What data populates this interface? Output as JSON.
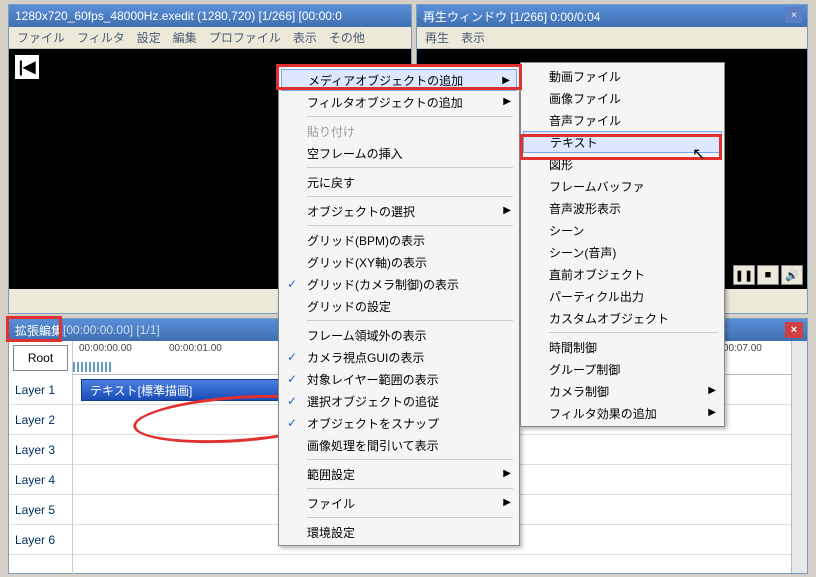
{
  "main_window": {
    "title": "1280x720_60fps_48000Hz.exedit (1280,720)  [1/266]  [00:00:0",
    "menubar": [
      "ファイル",
      "フィルタ",
      "設定",
      "編集",
      "プロファイル",
      "表示",
      "その他"
    ],
    "home_glyph": "|◀"
  },
  "playback_window": {
    "title": "再生ウィンドウ  [1/266]  0:00/0:04",
    "menubar": [
      "再生",
      "表示"
    ],
    "controls": {
      "pause": "❚❚",
      "stop": "■",
      "sound": "🔊"
    }
  },
  "timeline": {
    "title": "拡張編集",
    "info": "[00:00:00.00] [1/1]",
    "root": "Root",
    "layers": [
      "Layer 1",
      "Layer 2",
      "Layer 3",
      "Layer 4",
      "Layer 5",
      "Layer 6"
    ],
    "timecodes": [
      "00:00:00.00",
      "00:00:01.00",
      "00:00:07.00"
    ],
    "clip_label": "テキスト[標準描画]"
  },
  "context_menu": {
    "items": [
      {
        "label": "メディアオブジェクトの追加",
        "arrow": true,
        "hi": true
      },
      {
        "label": "フィルタオブジェクトの追加",
        "arrow": true
      },
      {
        "sep": true
      },
      {
        "label": "貼り付け",
        "disabled": true
      },
      {
        "label": "空フレームの挿入"
      },
      {
        "sep": true
      },
      {
        "label": "元に戻す"
      },
      {
        "sep": true
      },
      {
        "label": "オブジェクトの選択",
        "arrow": true
      },
      {
        "sep": true
      },
      {
        "label": "グリッド(BPM)の表示"
      },
      {
        "label": "グリッド(XY軸)の表示"
      },
      {
        "label": "グリッド(カメラ制御)の表示",
        "check": true
      },
      {
        "label": "グリッドの設定"
      },
      {
        "sep": true
      },
      {
        "label": "フレーム領域外の表示"
      },
      {
        "label": "カメラ視点GUIの表示",
        "check": true
      },
      {
        "label": "対象レイヤー範囲の表示",
        "check": true
      },
      {
        "label": "選択オブジェクトの追従",
        "check": true
      },
      {
        "label": "オブジェクトをスナップ",
        "check": true
      },
      {
        "label": "画像処理を間引いて表示"
      },
      {
        "sep": true
      },
      {
        "label": "範囲設定",
        "arrow": true
      },
      {
        "sep": true
      },
      {
        "label": "ファイル",
        "arrow": true
      },
      {
        "sep": true
      },
      {
        "label": "環境設定"
      }
    ]
  },
  "submenu": {
    "items": [
      {
        "label": "動画ファイル"
      },
      {
        "label": "画像ファイル"
      },
      {
        "label": "音声ファイル"
      },
      {
        "label": "テキスト",
        "hi": true
      },
      {
        "label": "図形"
      },
      {
        "label": "フレームバッファ"
      },
      {
        "label": "音声波形表示"
      },
      {
        "label": "シーン"
      },
      {
        "label": "シーン(音声)"
      },
      {
        "label": "直前オブジェクト"
      },
      {
        "label": "パーティクル出力"
      },
      {
        "label": "カスタムオブジェクト"
      },
      {
        "sep": true
      },
      {
        "label": "時間制御"
      },
      {
        "label": "グループ制御"
      },
      {
        "label": "カメラ制御",
        "arrow": true
      },
      {
        "label": "フィルタ効果の追加",
        "arrow": true
      }
    ]
  },
  "cursor": "↖"
}
